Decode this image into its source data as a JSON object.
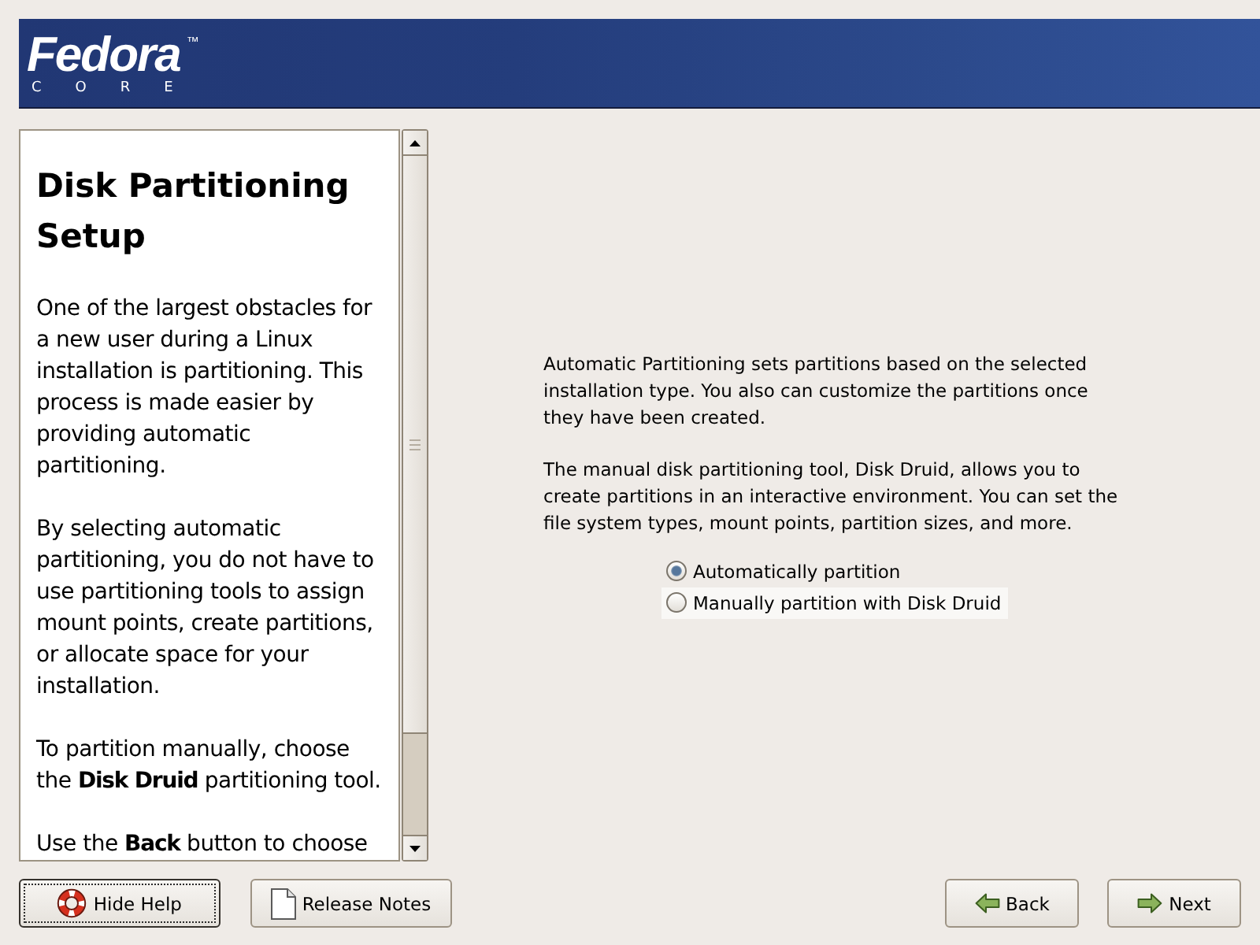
{
  "header": {
    "logo": {
      "wordmark": "Fedora",
      "trademark": "™",
      "subtitle": "CORE"
    }
  },
  "help": {
    "title": "Disk Partitioning Setup",
    "paragraphs": [
      "One of the largest obstacles for a new user during a Linux installation is partitioning. This process is made easier by providing automatic partitioning.",
      "By selecting automatic partitioning, you do not have to use partitioning tools to assign mount points, create partitions, or allocate space for your installation.",
      "To partition manually, choose the **Disk Druid** partitioning tool.",
      "Use the **Back** button to choose"
    ]
  },
  "content": {
    "paragraphs": [
      "Automatic Partitioning sets partitions based on the selected installation type. You also can customize the partitions once they have been created.",
      "The manual disk partitioning tool, Disk Druid, allows you to create partitions in an interactive environment. You can set the file system types, mount points, partition sizes, and more."
    ],
    "options": [
      {
        "label": "Automatically partition",
        "selected": true,
        "hovered": false
      },
      {
        "label": "Manually partition with Disk Druid",
        "selected": false,
        "hovered": true
      }
    ]
  },
  "buttons_left": [
    {
      "kind": "help",
      "label": "Hide Help",
      "focused": true
    },
    {
      "kind": "notes",
      "label": "Release Notes",
      "focused": false
    }
  ],
  "buttons_right": [
    {
      "kind": "back",
      "label": "Back",
      "focused": false
    },
    {
      "kind": "next",
      "label": "Next",
      "focused": false
    }
  ]
}
